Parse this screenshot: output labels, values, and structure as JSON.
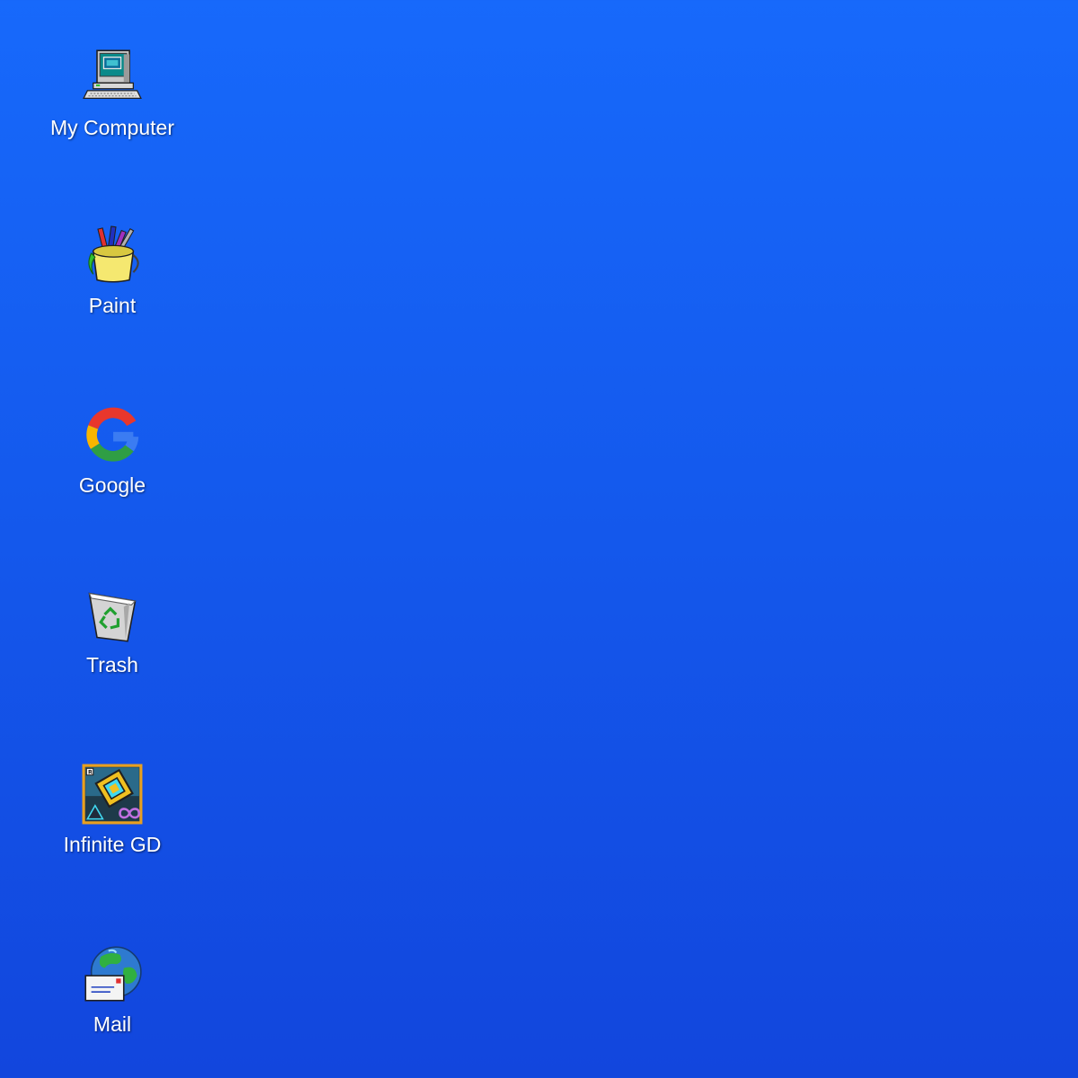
{
  "desktop": {
    "background_colors": [
      "#1769fb",
      "#1246dd"
    ],
    "icons": [
      {
        "label": "My Computer",
        "icon": "computer-icon"
      },
      {
        "label": "Paint",
        "icon": "paint-bucket-icon"
      },
      {
        "label": "Google",
        "icon": "google-icon"
      },
      {
        "label": "Trash",
        "icon": "recycle-bin-icon"
      },
      {
        "label": "Infinite GD",
        "icon": "geometry-dash-icon"
      },
      {
        "label": "Mail",
        "icon": "mail-globe-icon"
      }
    ]
  }
}
